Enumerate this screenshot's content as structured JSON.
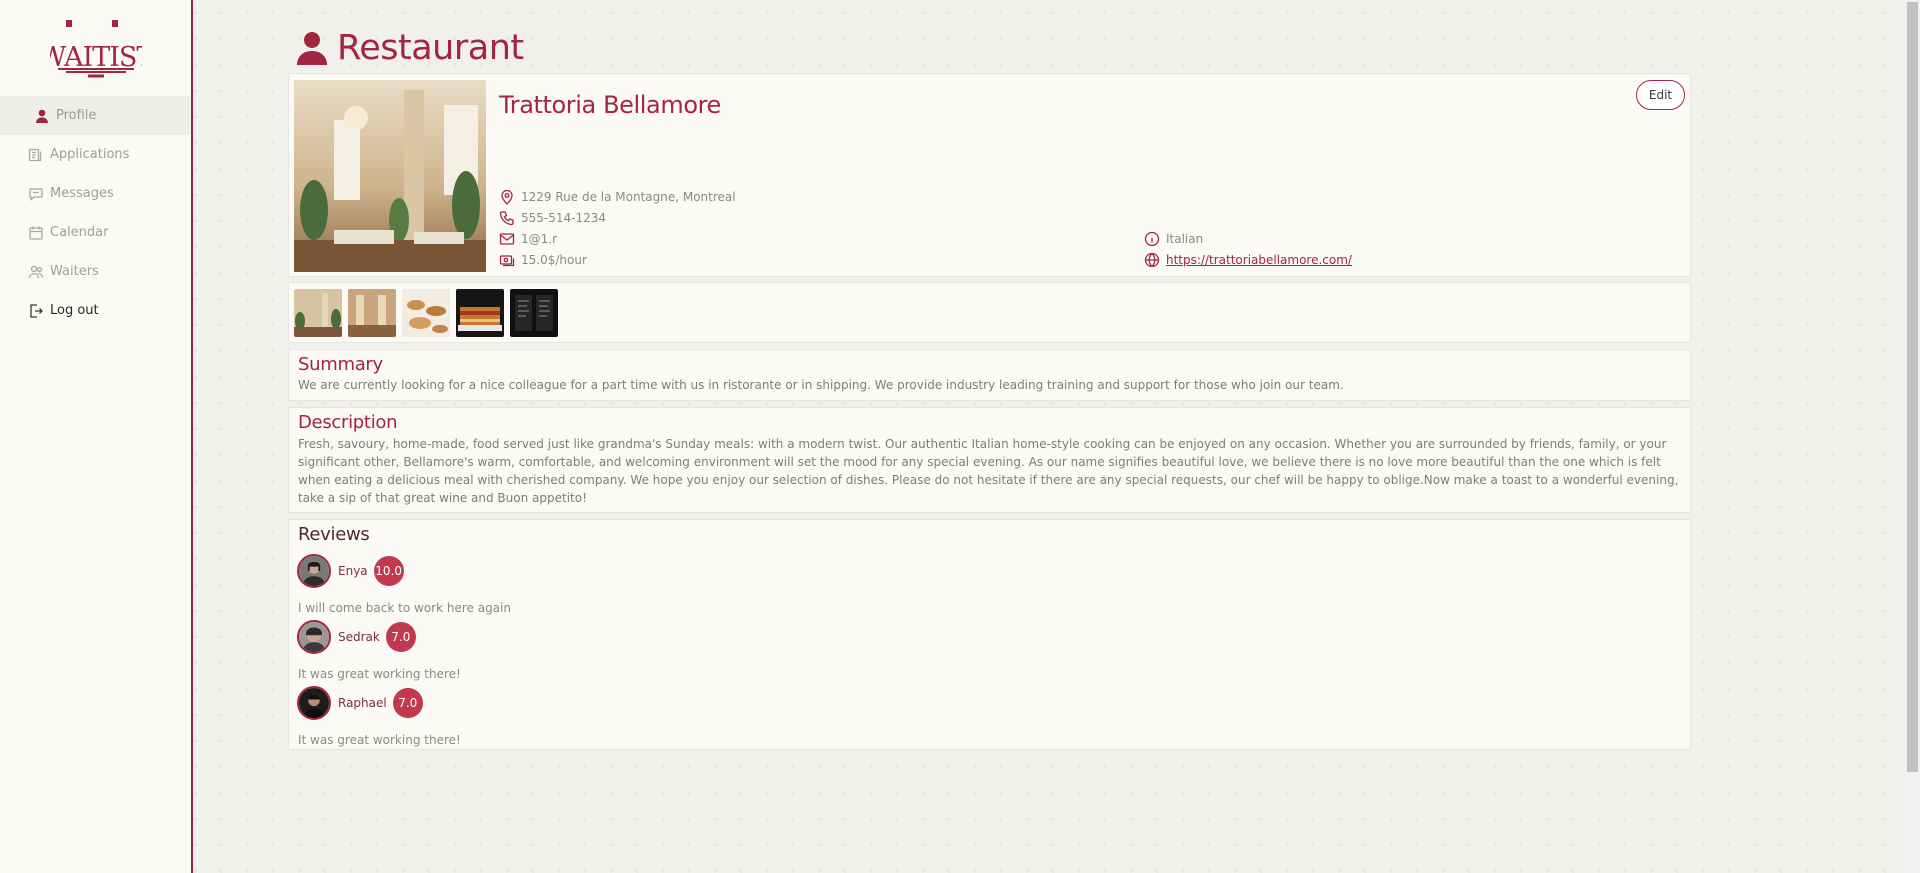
{
  "brand": {
    "logo_text": "WAITIST",
    "accent": "#a3253f"
  },
  "sidebar": {
    "items": [
      {
        "label": "Profile",
        "icon": "user-icon",
        "active": true
      },
      {
        "label": "Applications",
        "icon": "applications-icon"
      },
      {
        "label": "Messages",
        "icon": "message-icon"
      },
      {
        "label": "Calendar",
        "icon": "calendar-icon"
      },
      {
        "label": "Waiters",
        "icon": "users-icon"
      },
      {
        "label": "Log out",
        "icon": "logout-icon"
      }
    ]
  },
  "page": {
    "title": "Restaurant"
  },
  "profile": {
    "name": "Trattoria Bellamore",
    "edit_label": "Edit",
    "address": "1229 Rue de la Montagne, Montreal",
    "phone": "555-514-1234",
    "email": "1@1.r",
    "rate": "15.0$/hour",
    "cuisine": "Italian",
    "website": "https://trattoriabellamore.com/"
  },
  "gallery": {
    "images": [
      "dining-room-photo",
      "interior-photo",
      "pastries-photo",
      "lasagna-photo",
      "menu-photo"
    ]
  },
  "summary": {
    "title": "Summary",
    "text": "We are currently looking for a nice colleague for a part time with us in ristorante or in shipping. We provide industry leading training and support for those who join our team."
  },
  "description": {
    "title": "Description",
    "text": "Fresh, savoury, home-made, food served just like grandma's Sunday meals: with a modern twist. Our authentic Italian home-style cooking can be enjoyed on any occasion. Whether you are surrounded by friends, family, or your significant other, Bellamore's warm, comfortable, and welcoming environment will set the mood for any special evening. As our name signifies beautiful love, we believe there is no love more beautiful than the one which is felt when eating a delicious meal with cherished company. We hope you enjoy our selection of dishes. Please do not hesitate if there are any special requests, our chef will be happy to oblige.Now make a toast to a wonderful evening, take a sip of that great wine and Buon appetito!"
  },
  "reviews": {
    "title": "Reviews",
    "items": [
      {
        "name": "Enya",
        "score": "10.0",
        "text": "I will come back to work here again"
      },
      {
        "name": "Sedrak",
        "score": "7.0",
        "text": "It was great working there!"
      },
      {
        "name": "Raphael",
        "score": "7.0",
        "text": "It was great working there!"
      }
    ]
  }
}
